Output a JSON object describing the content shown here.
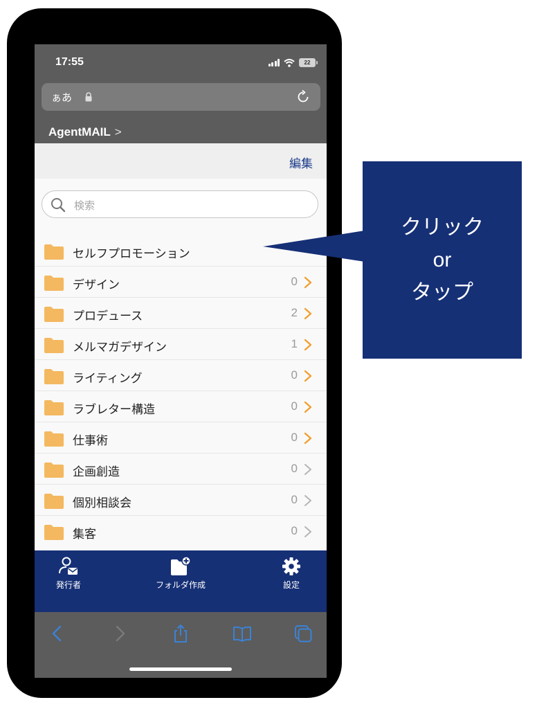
{
  "status_bar": {
    "time": "17:55",
    "battery": "22"
  },
  "browser": {
    "text_size_label": "ぁあ"
  },
  "breadcrumb": {
    "label": "AgentMAIL",
    "separator": ">"
  },
  "header": {
    "edit_label": "編集"
  },
  "search": {
    "placeholder": "検索"
  },
  "folders": [
    {
      "name": "セルフプロモーション",
      "count": ""
    },
    {
      "name": "デザイン",
      "count": "0"
    },
    {
      "name": "プロデュース",
      "count": "2"
    },
    {
      "name": "メルマガデザイン",
      "count": "1"
    },
    {
      "name": "ライティング",
      "count": "0"
    },
    {
      "name": "ラブレター構造",
      "count": "0"
    },
    {
      "name": "仕事術",
      "count": "0"
    },
    {
      "name": "企画創造",
      "count": "0"
    },
    {
      "name": "個別相談会",
      "count": "0"
    },
    {
      "name": "集客",
      "count": "0"
    }
  ],
  "tab_bar": {
    "sender_label": "発行者",
    "create_folder_label": "フォルダ作成",
    "settings_label": "設定"
  },
  "callout": {
    "lines": [
      "クリック",
      "or",
      "タップ"
    ]
  },
  "colors": {
    "tab_bar": "#163076",
    "callout": "#163076",
    "folder": "#f4b860",
    "accent_link": "#1a3a8a",
    "chevron_active": "#f0a030",
    "chevron_inactive": "#b5b5b5",
    "toolbar_icon": "#3b82d6"
  },
  "icons": {
    "tab_bar": [
      "user-mail-icon",
      "folder-plus-icon",
      "gear-icon"
    ],
    "toolbar": [
      "back-icon",
      "forward-icon",
      "share-icon",
      "bookmarks-icon",
      "tabs-icon"
    ],
    "folder": "folder-icon"
  }
}
